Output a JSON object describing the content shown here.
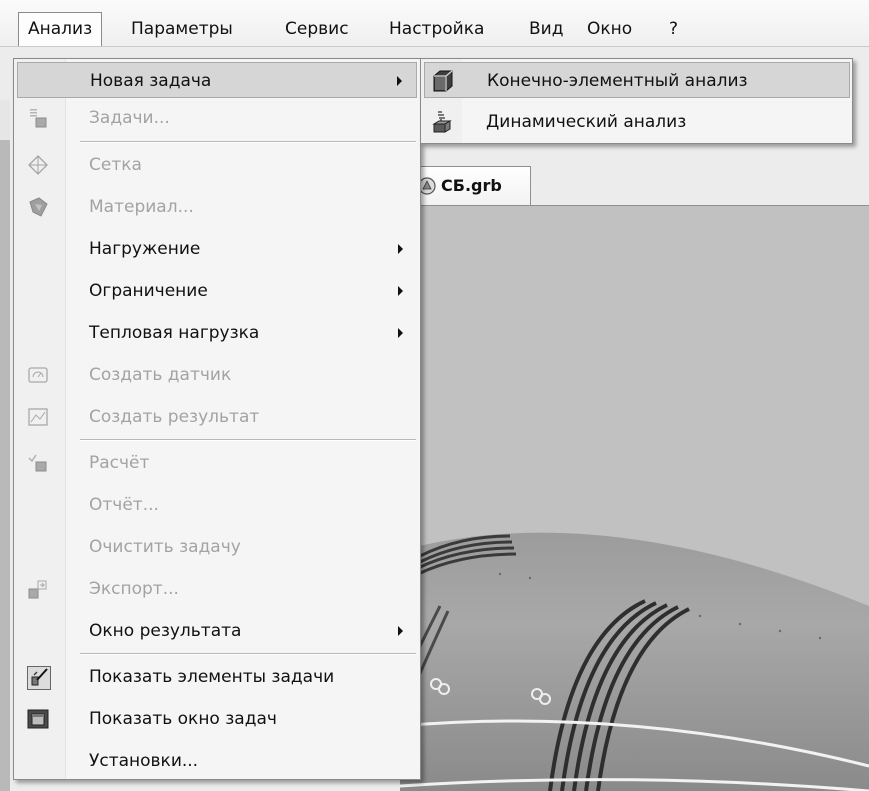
{
  "menubar": {
    "items": [
      "Анализ",
      "Параметры",
      "Сервис",
      "Настройка",
      "Вид",
      "Окно",
      "?"
    ]
  },
  "document_tab": {
    "label": "СБ.grb"
  },
  "dropdown": {
    "items": [
      {
        "label": "Новая задача",
        "enabled": true,
        "submenu": true,
        "icon": "none"
      },
      {
        "label": "Задачи...",
        "enabled": false,
        "icon": "tasks-icon"
      },
      {
        "label": "Сетка",
        "enabled": false,
        "icon": "mesh-icon"
      },
      {
        "label": "Материал...",
        "enabled": false,
        "icon": "material-icon"
      },
      {
        "label": "Нагружение",
        "enabled": true,
        "submenu": true,
        "icon": "none"
      },
      {
        "label": "Ограничение",
        "enabled": true,
        "submenu": true,
        "icon": "none"
      },
      {
        "label": "Тепловая нагрузка",
        "enabled": true,
        "submenu": true,
        "icon": "none"
      },
      {
        "label": "Создать датчик",
        "enabled": false,
        "icon": "sensor-icon"
      },
      {
        "label": "Создать результат",
        "enabled": false,
        "icon": "result-icon"
      },
      {
        "label": "Расчёт",
        "enabled": false,
        "icon": "calculate-icon"
      },
      {
        "label": "Отчёт...",
        "enabled": false,
        "icon": "none"
      },
      {
        "label": "Очистить задачу",
        "enabled": false,
        "icon": "none"
      },
      {
        "label": "Экспорт...",
        "enabled": false,
        "icon": "export-icon"
      },
      {
        "label": "Окно результата",
        "enabled": true,
        "submenu": true,
        "icon": "none"
      },
      {
        "label": "Показать элементы задачи",
        "enabled": true,
        "icon": "show-elements-icon"
      },
      {
        "label": "Показать окно задач",
        "enabled": true,
        "icon": "task-window-icon"
      },
      {
        "label": "Установки...",
        "enabled": true,
        "icon": "none"
      }
    ]
  },
  "submenu": {
    "items": [
      {
        "label": "Конечно-элементный анализ",
        "icon": "fea-cube-icon"
      },
      {
        "label": "Динамический анализ",
        "icon": "dynamic-analysis-icon"
      }
    ]
  },
  "colors": {
    "menu_background": "#f5f5f5",
    "highlight": "#d6d6d6",
    "disabled_text": "#a3a3a3",
    "viewport": "#c0c0c0"
  }
}
